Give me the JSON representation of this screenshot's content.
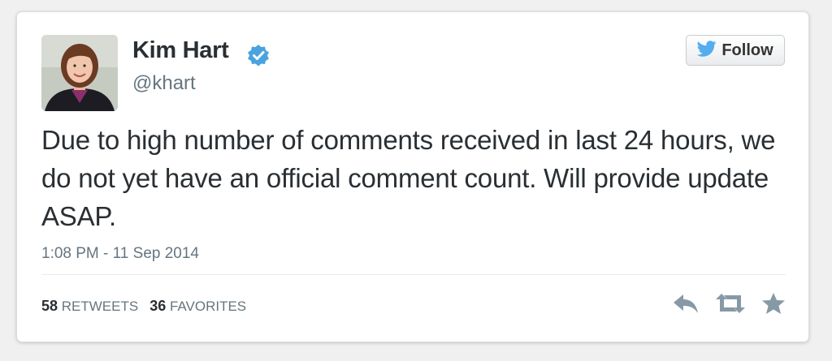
{
  "user": {
    "display_name": "Kim Hart",
    "handle": "@khart",
    "verified": true
  },
  "follow_button": {
    "label": "Follow"
  },
  "tweet": {
    "text": "Due to high number of comments received in last 24 hours, we do not yet have an official comment count. Will provide update ASAP.",
    "timestamp": "1:08 PM - 11 Sep 2014"
  },
  "stats": {
    "retweets_count": "58",
    "retweets_label": "RETWEETS",
    "favorites_count": "36",
    "favorites_label": "FAVORITES"
  },
  "icons": {
    "verified": "verified-badge-icon",
    "follow": "twitter-bird-icon",
    "reply": "reply-icon",
    "retweet": "retweet-icon",
    "favorite": "star-icon"
  },
  "colors": {
    "verified_blue": "#4aa3df",
    "twitter_blue": "#55acee",
    "text_dark": "#292f33",
    "text_muted": "#66757f",
    "action_gray": "#8899a6"
  }
}
